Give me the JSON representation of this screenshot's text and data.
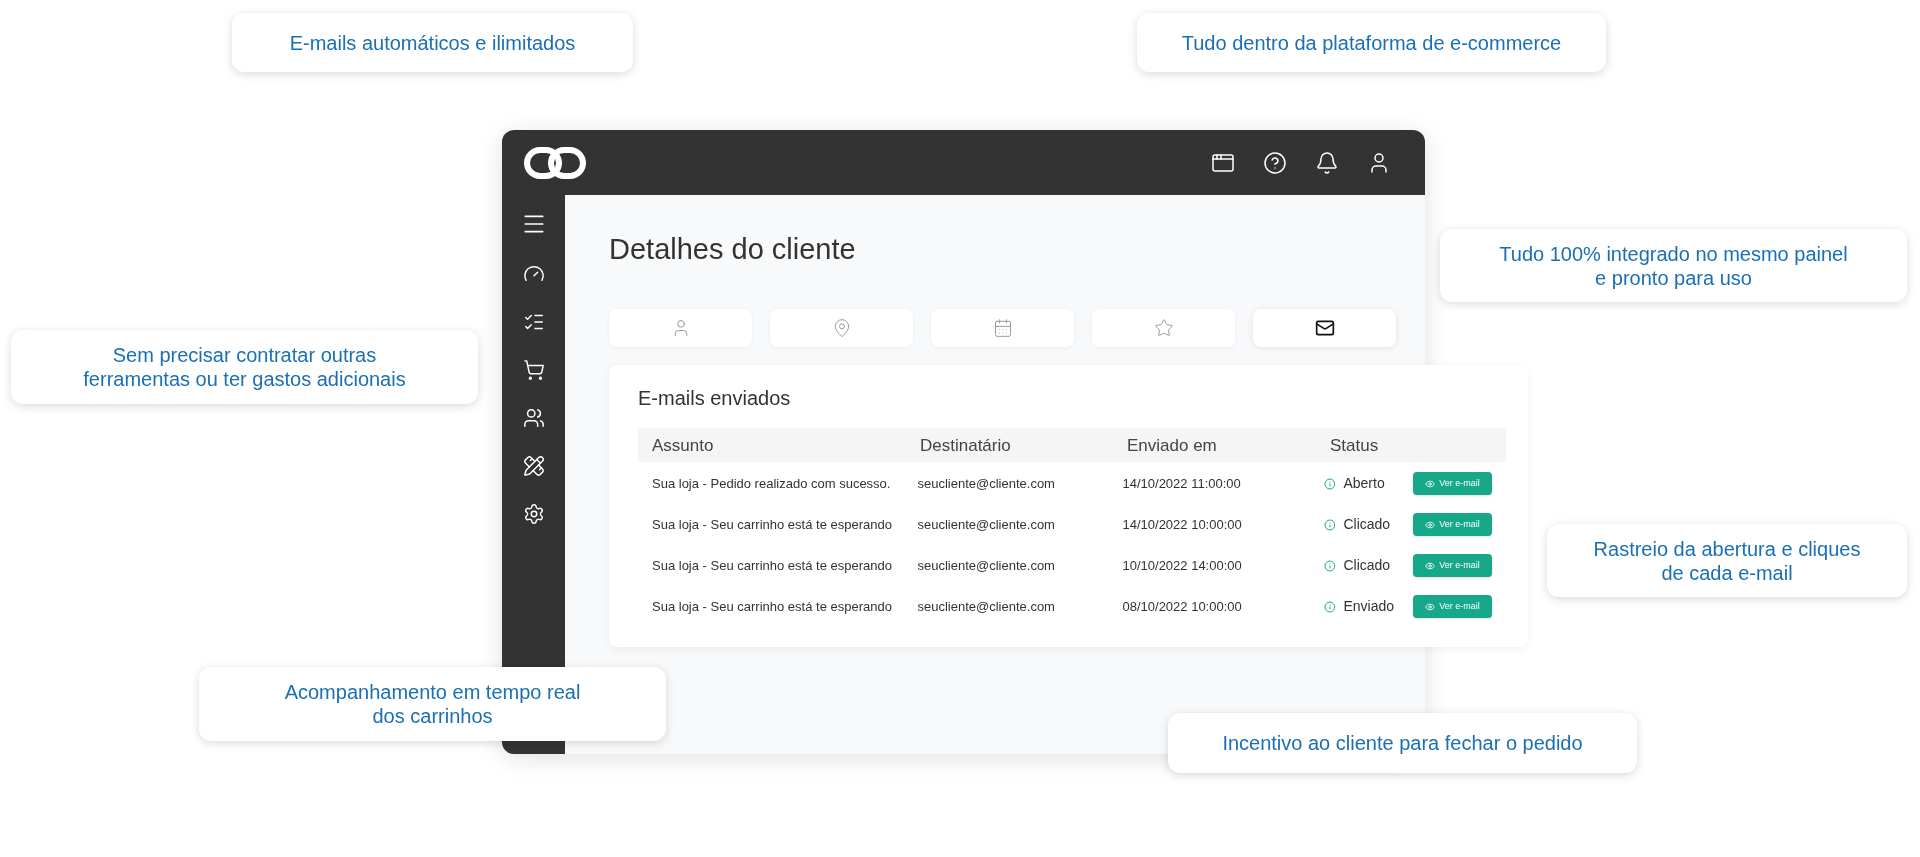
{
  "callouts": [
    {
      "lines": [
        "E-mails automáticos e ilimitados"
      ]
    },
    {
      "lines": [
        "Tudo dentro da plataforma de e-commerce"
      ]
    },
    {
      "lines": [
        "Tudo 100% integrado no mesmo painel",
        "e pronto para uso"
      ]
    },
    {
      "lines": [
        "Sem precisar contratar outras",
        "ferramentas ou ter gastos adicionais"
      ]
    },
    {
      "lines": [
        "Rastreio da abertura e cliques",
        "de cada e-mail"
      ]
    },
    {
      "lines": [
        "Acompanhamento em tempo real",
        "dos carrinhos"
      ]
    },
    {
      "lines": [
        "Incentivo ao cliente para fechar o pedido"
      ]
    }
  ],
  "page": {
    "title": "Detalhes do cliente"
  },
  "tabs": [
    {
      "selected": false
    },
    {
      "selected": false
    },
    {
      "selected": false
    },
    {
      "selected": false
    },
    {
      "selected": true
    }
  ],
  "card": {
    "title": "E-mails enviados",
    "columns": [
      "Assunto",
      "Destinatário",
      "Enviado em",
      "Status"
    ],
    "rows": [
      {
        "subject": "Sua loja - Pedido realizado com sucesso.",
        "recipient": "seucliente@cliente.com",
        "sent": "14/10/2022 11:00:00",
        "status": "Aberto",
        "action": "Ver e-mail"
      },
      {
        "subject": "Sua loja - Seu carrinho está te esperando",
        "recipient": "seucliente@cliente.com",
        "sent": "14/10/2022 10:00:00",
        "status": "Clicado",
        "action": "Ver e-mail"
      },
      {
        "subject": "Sua loja - Seu carrinho está te esperando",
        "recipient": "seucliente@cliente.com",
        "sent": "10/10/2022 14:00:00",
        "status": "Clicado",
        "action": "Ver e-mail"
      },
      {
        "subject": "Sua loja - Seu carrinho está te esperando",
        "recipient": "seucliente@cliente.com",
        "sent": "08/10/2022 10:00:00",
        "status": "Enviado",
        "action": "Ver e-mail"
      }
    ]
  }
}
